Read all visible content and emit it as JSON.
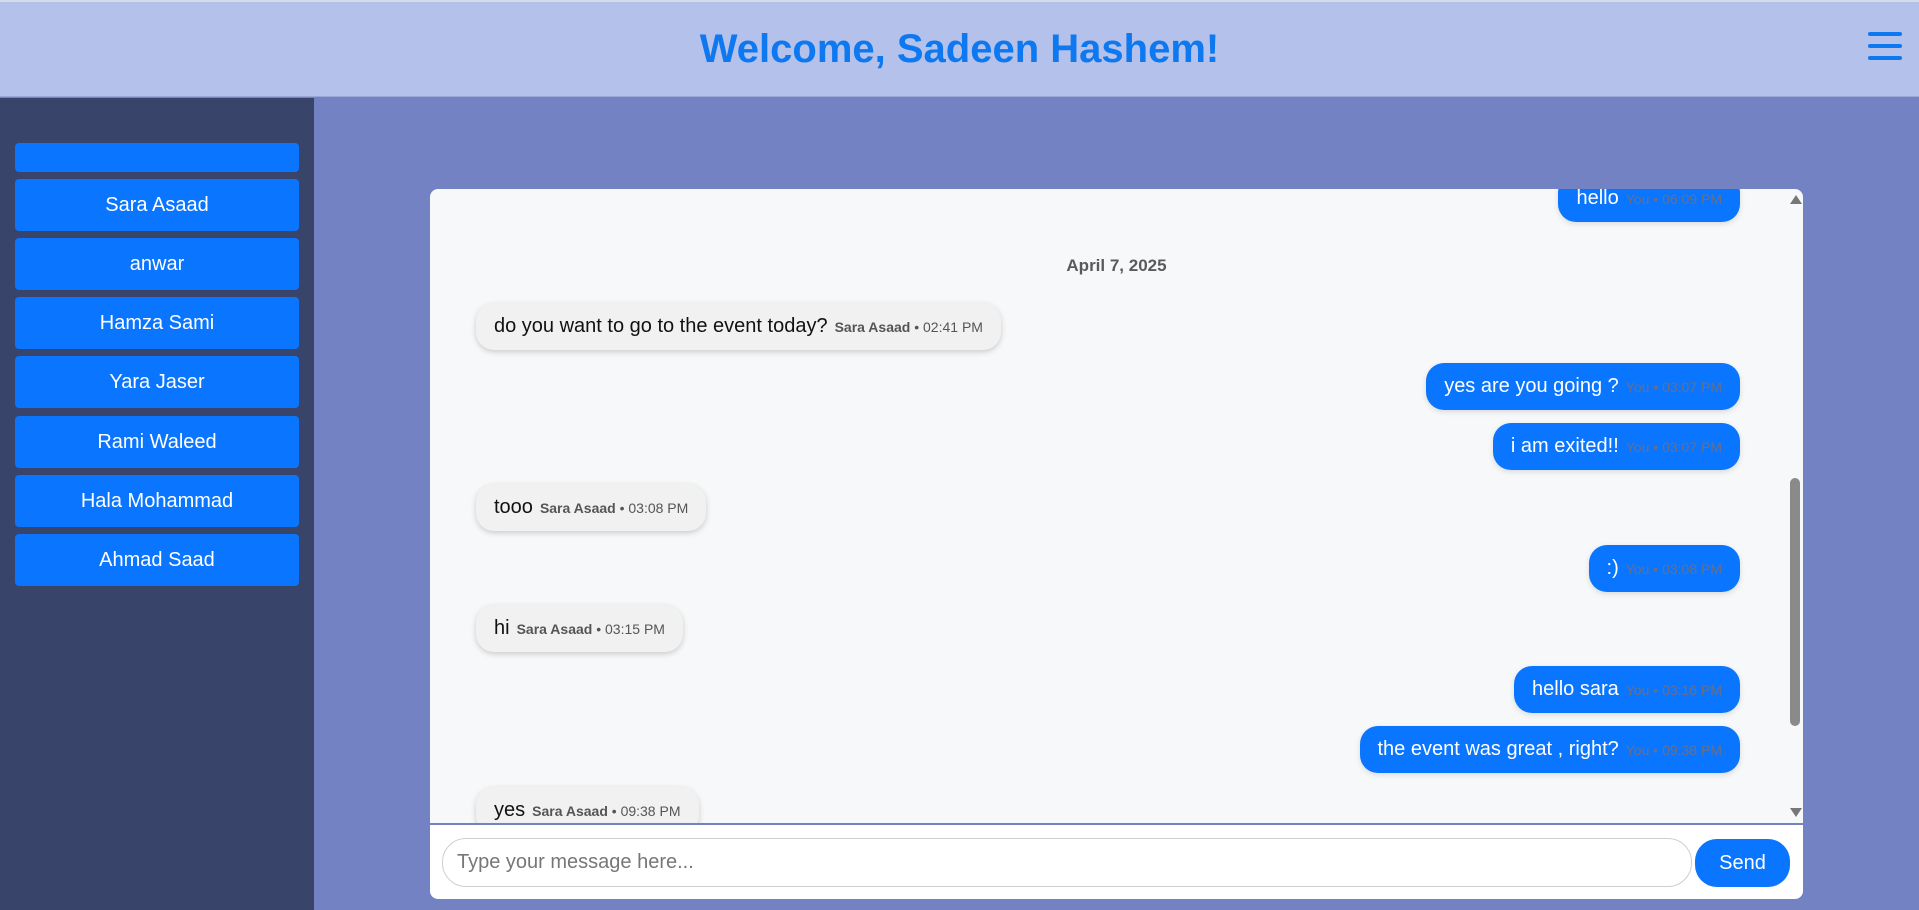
{
  "header": {
    "title": "Welcome, Sadeen Hashem!",
    "menu_icon": "hamburger-menu-icon"
  },
  "sidebar": {
    "contacts": [
      "",
      "Sara Asaad",
      "anwar",
      "Hamza Sami",
      "Yara Jaser",
      "Rami Waleed",
      "Hala Mohammad",
      "Ahmad Saad"
    ]
  },
  "chat": {
    "date_separator": "April 7, 2025",
    "messages": [
      {
        "direction": "out",
        "text": "hello",
        "sender": "You",
        "time": "06:09 PM"
      },
      {
        "direction": "in",
        "text": "do you want to go to the event today?",
        "sender": "Sara Asaad",
        "time": "02:41 PM"
      },
      {
        "direction": "out",
        "text": "yes are you going ?",
        "sender": "You",
        "time": "03:07 PM"
      },
      {
        "direction": "out",
        "text": "i am exited!!",
        "sender": "You",
        "time": "03:07 PM"
      },
      {
        "direction": "in",
        "text": "tooo",
        "sender": "Sara Asaad",
        "time": "03:08 PM"
      },
      {
        "direction": "out",
        "text": ":)",
        "sender": "You",
        "time": "03:08 PM"
      },
      {
        "direction": "in",
        "text": "hi",
        "sender": "Sara Asaad",
        "time": "03:15 PM"
      },
      {
        "direction": "out",
        "text": "hello sara",
        "sender": "You",
        "time": "03:16 PM"
      },
      {
        "direction": "out",
        "text": "the event was great , right?",
        "sender": "You",
        "time": "09:38 PM"
      },
      {
        "direction": "in",
        "text": "yes",
        "sender": "Sara Asaad",
        "time": "09:38 PM"
      }
    ]
  },
  "composer": {
    "placeholder": "Type your message here...",
    "send_label": "Send"
  },
  "colors": {
    "accent": "#0a75ff",
    "header_bg": "#b4c1ea",
    "sidebar_bg": "#39446b",
    "page_bg": "#7282c2",
    "title": "#0d78f0"
  }
}
